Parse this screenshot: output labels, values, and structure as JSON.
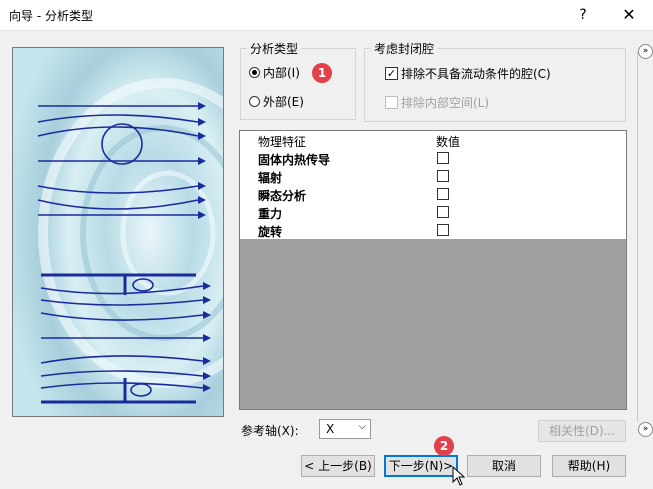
{
  "window": {
    "title": "向导 - 分析类型",
    "help_label": "?",
    "close_label": "✕"
  },
  "analysis_type": {
    "title": "分析类型",
    "options": [
      {
        "label": "内部(I)",
        "selected": true
      },
      {
        "label": "外部(E)",
        "selected": false
      }
    ]
  },
  "closed_cavities": {
    "title": "考虑封闭腔",
    "options": [
      {
        "label": "排除不具备流动条件的腔(C)",
        "checked": true,
        "enabled": true
      },
      {
        "label": "排除内部空间(L)",
        "checked": false,
        "enabled": false
      }
    ]
  },
  "physics_table": {
    "headers": [
      "物理特征",
      "数值"
    ],
    "rows": [
      {
        "name": "固体内热传导",
        "checked": false
      },
      {
        "name": "辐射",
        "checked": false
      },
      {
        "name": "瞬态分析",
        "checked": false
      },
      {
        "name": "重力",
        "checked": false
      },
      {
        "name": "旋转",
        "checked": false
      }
    ]
  },
  "reference_axis": {
    "label": "参考轴(X):",
    "value": "X"
  },
  "buttons": {
    "dependency": "相关性(D)...",
    "back": "< 上一步(B)",
    "next": "下一步(N)>",
    "cancel": "取消",
    "help": "帮助(H)"
  },
  "badges": [
    "1",
    "2"
  ],
  "icons": {
    "expand": "»"
  },
  "colors": {
    "badge": "#e0414b",
    "flow_lines": "#1a2b9c",
    "table_background": "#a0a0a0",
    "default_button_border": "#0078d7"
  }
}
